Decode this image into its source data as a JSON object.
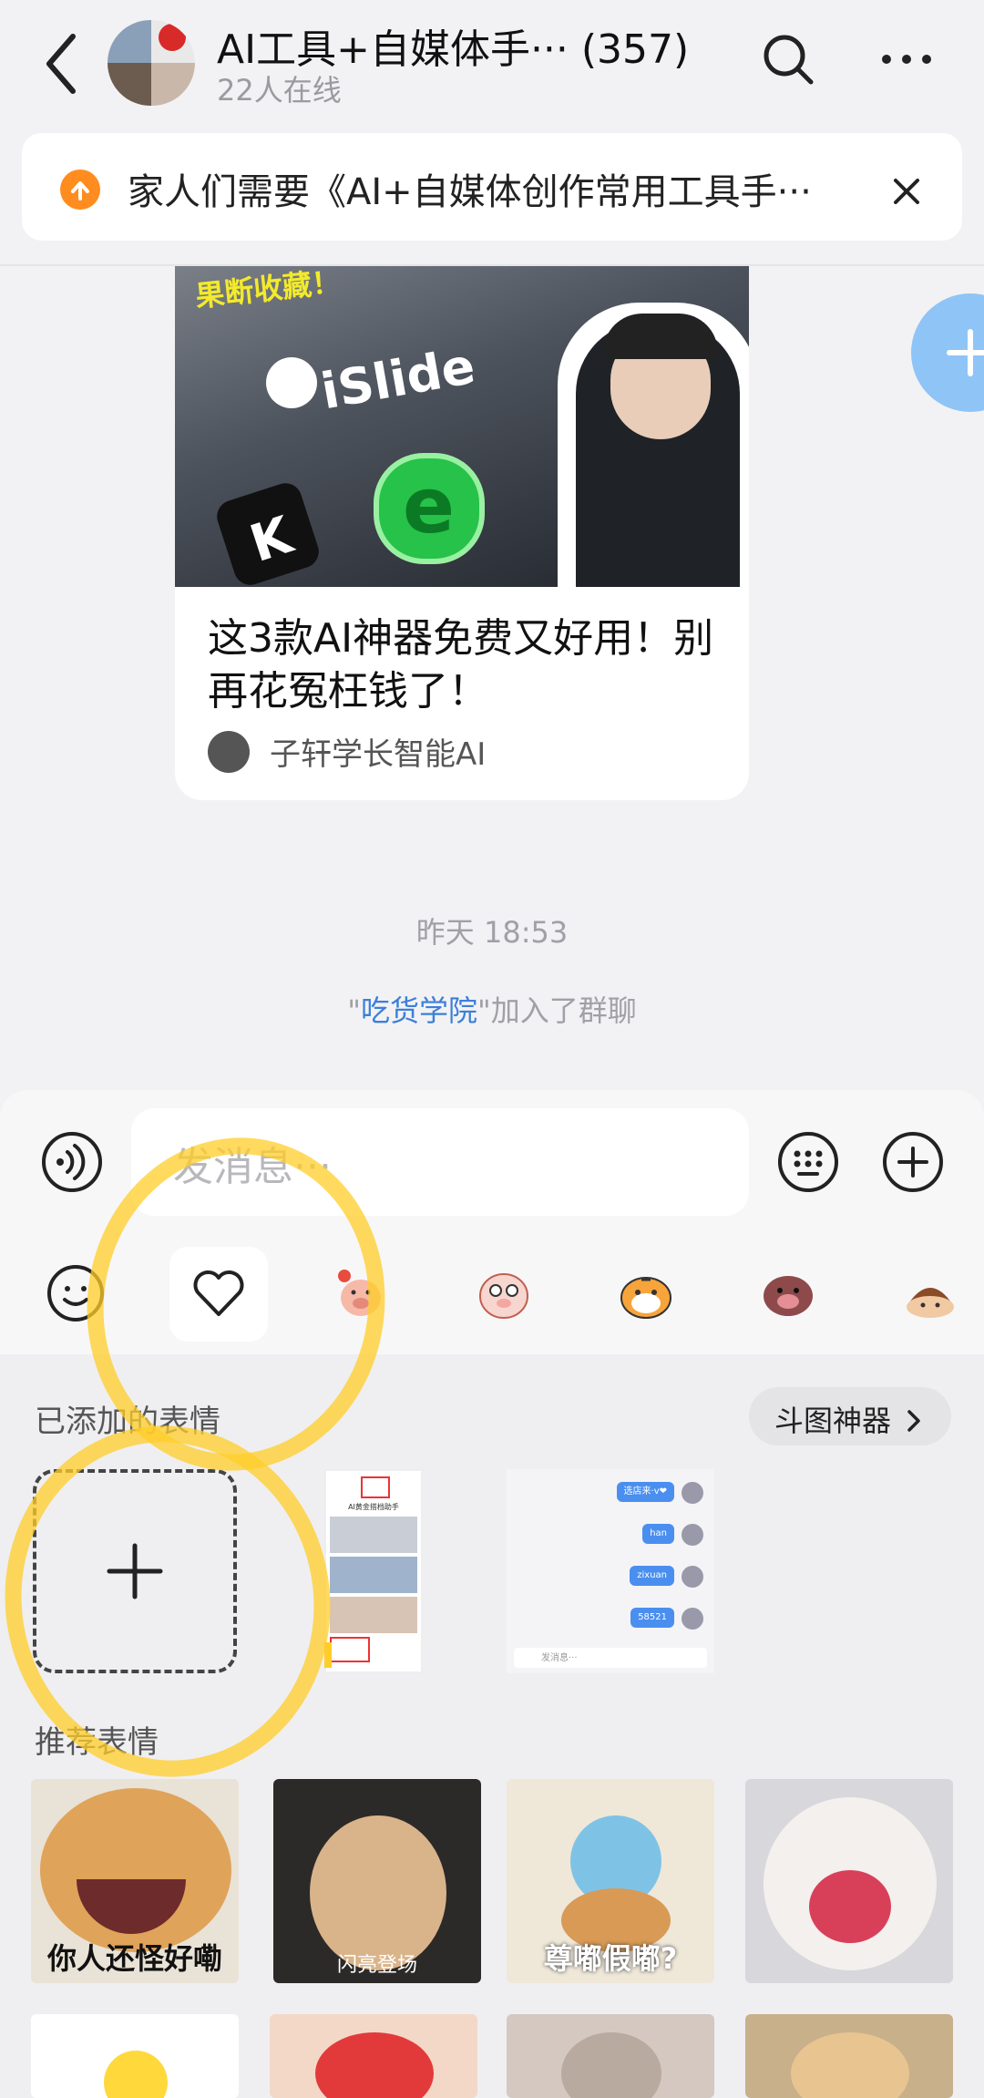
{
  "header": {
    "title": "AI工具+自媒体手··· (357)",
    "online": "22人在线"
  },
  "notice": {
    "text": "家人们需要《AI+自媒体创作常用工具手···"
  },
  "card": {
    "title": "这3款AI神器免费又好用！别再花冤枉钱了！",
    "author": "子轩学长智能AI",
    "image_text": {
      "badge": "果断收藏！",
      "brand": "iSlide"
    }
  },
  "timeline": {
    "timestamp": "昨天 18:53",
    "join_name": "吃货学院",
    "join_prefix": "\"",
    "join_suffix": "\"加入了群聊"
  },
  "input": {
    "placeholder": "发消息···"
  },
  "tabs": [
    "smiley",
    "favorite-heart",
    "sticker-pig-ribbon",
    "sticker-pig-surprised",
    "sticker-tiger",
    "sticker-boar",
    "sticker-chestnut"
  ],
  "panel": {
    "added_label": "已添加的表情",
    "doutu_label": "斗图神器",
    "recommended_label": "推荐表情",
    "shot2_bubbles": [
      "选店来·v❤",
      "han",
      "zixuan",
      "58521"
    ],
    "shot2_input": "发消息···",
    "shot1_title": "AI黄金搭档助手",
    "stickers_row1": [
      {
        "caption": "你人还怪好嘞"
      },
      {
        "caption": "闪亮登场"
      },
      {
        "caption": "尊嘟假嘟?"
      },
      {
        "caption": ""
      }
    ]
  },
  "colors": {
    "accent": "#3d7fd8",
    "notice_icon": "#ff8c1f",
    "fab": "#8fc4f7",
    "highlight": "#ffcd28"
  }
}
